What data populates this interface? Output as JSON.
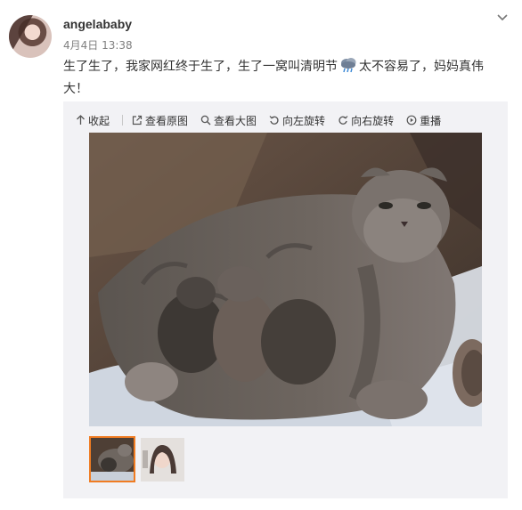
{
  "post": {
    "username": "angelababy",
    "timestamp": "4月4日 13:38",
    "text_part1": "生了生了，我家网红终于生了，生了一窝叫清明节",
    "emoji_icon": "rain-cloud-emoji-icon",
    "text_part2": "太不容易了，妈妈真伟大！"
  },
  "toolbar": {
    "collapse_label": "收起",
    "view_original_label": "查看原图",
    "view_large_label": "查看大图",
    "rotate_left_label": "向左旋转",
    "rotate_right_label": "向右旋转",
    "replay_label": "重播"
  },
  "thumbnails": [
    {
      "description": "cat-with-kittens",
      "selected": true
    },
    {
      "description": "woman-selfie",
      "selected": false
    }
  ],
  "colors": {
    "selected_border": "#f07c22",
    "media_bg": "#f2f2f5",
    "meta_text": "#808080"
  }
}
